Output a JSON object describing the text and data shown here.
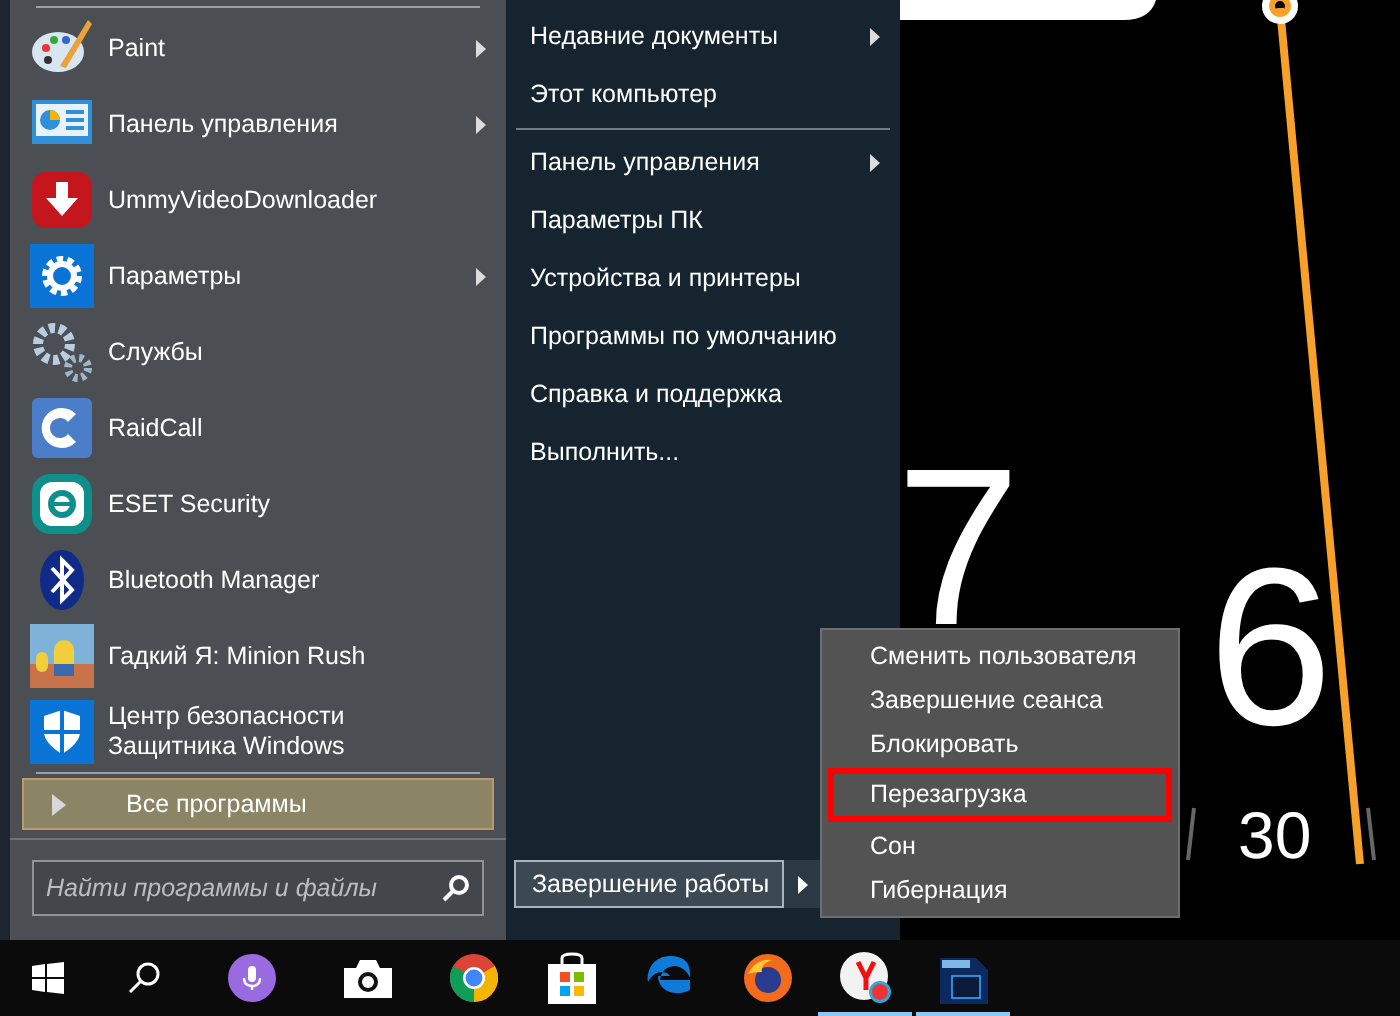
{
  "left_menu": {
    "items": [
      {
        "label": "Paint",
        "kind": "palette",
        "has_submenu": true
      },
      {
        "label": "Панель управления",
        "kind": "panel",
        "has_submenu": true
      },
      {
        "label": "UmmyVideoDownloader",
        "kind": "download",
        "has_submenu": false
      },
      {
        "label": "Параметры",
        "kind": "gear",
        "has_submenu": true
      },
      {
        "label": "Службы",
        "kind": "gears",
        "has_submenu": false
      },
      {
        "label": "RaidCall",
        "kind": "raidcall",
        "has_submenu": false
      },
      {
        "label": "ESET Security",
        "kind": "eset",
        "has_submenu": false
      },
      {
        "label": "Bluetooth Manager",
        "kind": "bluetooth",
        "has_submenu": false
      },
      {
        "label": "Гадкий Я: Minion Rush",
        "kind": "picture",
        "has_submenu": false
      },
      {
        "label": "Центр безопасности\nЗащитника Windows",
        "kind": "shield",
        "has_submenu": false
      }
    ],
    "all_programs": {
      "label": "Все программы",
      "selected": true
    },
    "search": {
      "placeholder": "Найти программы и файлы"
    }
  },
  "right_menu": {
    "sections": [
      {
        "items": [
          {
            "label": "Недавние документы",
            "has_submenu": true
          },
          {
            "label": "Этот компьютер",
            "has_submenu": false
          }
        ]
      },
      {
        "items": [
          {
            "label": "Панель управления",
            "has_submenu": true
          },
          {
            "label": "Параметры ПК",
            "has_submenu": false
          },
          {
            "label": "Устройства и принтеры",
            "has_submenu": false
          },
          {
            "label": "Программы по умолчанию",
            "has_submenu": false
          },
          {
            "label": "Справка и поддержка",
            "has_submenu": false
          },
          {
            "label": "Выполнить...",
            "has_submenu": false
          }
        ]
      }
    ]
  },
  "shutdown": {
    "label": "Завершение работы"
  },
  "shutdown_menu": {
    "items": [
      {
        "label": "Сменить пользователя",
        "highlighted": false
      },
      {
        "label": "Завершение сеанса",
        "highlighted": false
      },
      {
        "label": "Блокировать",
        "highlighted": false
      },
      {
        "label": "Перезагрузка",
        "highlighted": true
      },
      {
        "label": "Сон",
        "highlighted": false
      },
      {
        "label": "Гибернация",
        "highlighted": false
      }
    ]
  },
  "desktop_clock": {
    "hour_labels": [
      "7",
      "6"
    ],
    "minute_label": "30"
  },
  "taskbar": {
    "items": [
      {
        "kind": "start",
        "running": false
      },
      {
        "kind": "search",
        "running": false
      },
      {
        "kind": "mic",
        "running": false
      },
      {
        "kind": "camera",
        "running": false
      },
      {
        "kind": "chrome",
        "running": false
      },
      {
        "kind": "store",
        "running": false
      },
      {
        "kind": "edge",
        "running": false
      },
      {
        "kind": "firefox",
        "running": false
      },
      {
        "kind": "yandex",
        "running": true
      },
      {
        "kind": "photoshop",
        "running": true
      }
    ]
  }
}
